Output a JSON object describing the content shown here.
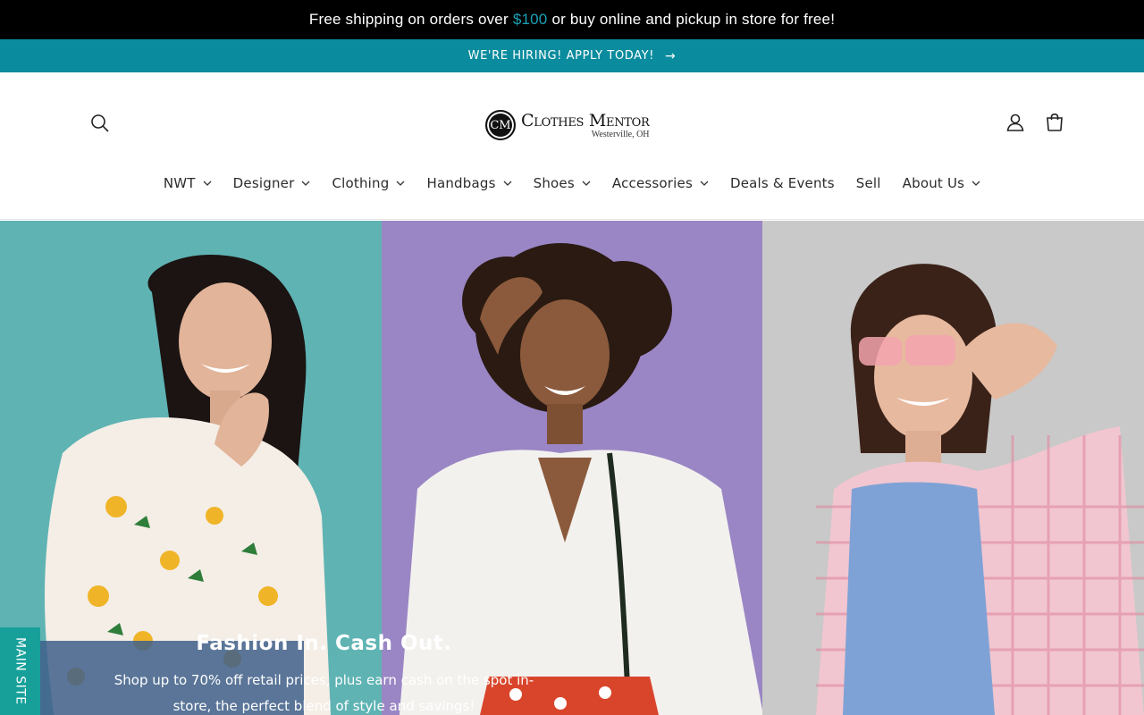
{
  "announcement": {
    "prefix": "Free shipping on orders over",
    "amount": "$100",
    "suffix": "or buy online and pickup in store for free!"
  },
  "hiring_banner": {
    "label": "WE'RE HIRING! APPLY TODAY!",
    "arrow": "→"
  },
  "header": {
    "logo": {
      "monogram": "CM",
      "name": "Clothes Mentor",
      "location": "Westerville, OH"
    },
    "icons": {
      "search": "search-icon",
      "account": "account-icon",
      "cart": "cart-icon"
    }
  },
  "nav": {
    "items": [
      {
        "label": "NWT",
        "has_dropdown": true
      },
      {
        "label": "Designer",
        "has_dropdown": true
      },
      {
        "label": "Clothing",
        "has_dropdown": true
      },
      {
        "label": "Handbags",
        "has_dropdown": true
      },
      {
        "label": "Shoes",
        "has_dropdown": true
      },
      {
        "label": "Accessories",
        "has_dropdown": true
      },
      {
        "label": "Deals & Events",
        "has_dropdown": false
      },
      {
        "label": "Sell",
        "has_dropdown": false
      },
      {
        "label": "About Us",
        "has_dropdown": true
      }
    ]
  },
  "hero": {
    "title": "Fashion In. Cash Out.",
    "subtitle_line1": "Shop up to 70% off retail prices, plus earn cash on the spot in-",
    "subtitle_line2": "store, the perfect blend of style and savings!",
    "panels": [
      {
        "bg": "#5fb3b3",
        "subject": "woman-floral-shirt"
      },
      {
        "bg": "#9a86c4",
        "subject": "woman-white-blouse"
      },
      {
        "bg": "#c9c9c9",
        "subject": "woman-pink-gingham"
      }
    ]
  },
  "side_tab": {
    "label": "MAIN SITE"
  },
  "colors": {
    "topbar": "#000000",
    "hiring": "#0a8c9e",
    "accent": "#1aa3b5",
    "side_tab": "#17a09a"
  }
}
